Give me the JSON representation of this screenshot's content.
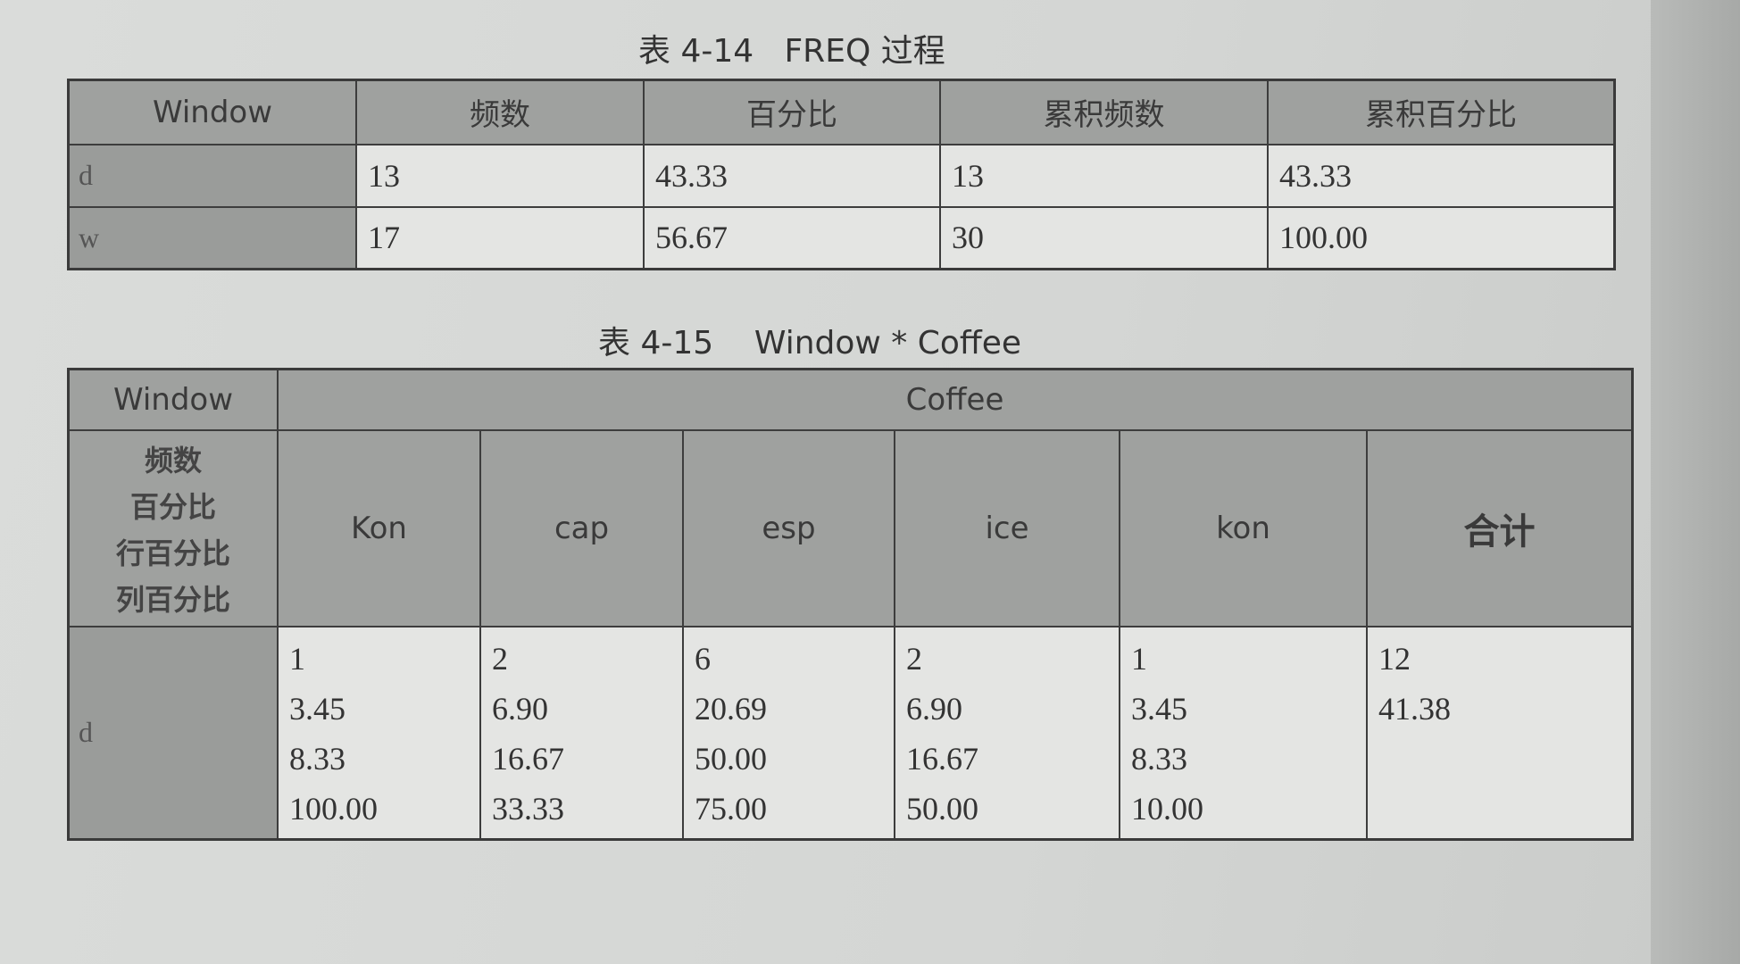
{
  "table1": {
    "caption": "表 4-14   FREQ 过程",
    "headers": [
      "Window",
      "频数",
      "百分比",
      "累积频数",
      "累积百分比"
    ],
    "rows": [
      {
        "label": "d",
        "cells": [
          "13",
          "43.33",
          "13",
          "43.33"
        ]
      },
      {
        "label": "w",
        "cells": [
          "17",
          "56.67",
          "30",
          "100.00"
        ]
      }
    ]
  },
  "table2": {
    "caption": "表 4-15    Window * Coffee",
    "corner": "Window",
    "group_header": "Coffee",
    "stat_labels": [
      "频数",
      "百分比",
      "行百分比",
      "列百分比"
    ],
    "columns": [
      "Kon",
      "cap",
      "esp",
      "ice",
      "kon",
      "合计"
    ],
    "row_label": "d",
    "values": [
      [
        "1",
        "3.45",
        "8.33",
        "100.00"
      ],
      [
        "2",
        "6.90",
        "16.67",
        "33.33"
      ],
      [
        "6",
        "20.69",
        "50.00",
        "75.00"
      ],
      [
        "2",
        "6.90",
        "16.67",
        "50.00"
      ],
      [
        "1",
        "3.45",
        "8.33",
        "10.00"
      ],
      [
        "12",
        "41.38"
      ]
    ]
  }
}
